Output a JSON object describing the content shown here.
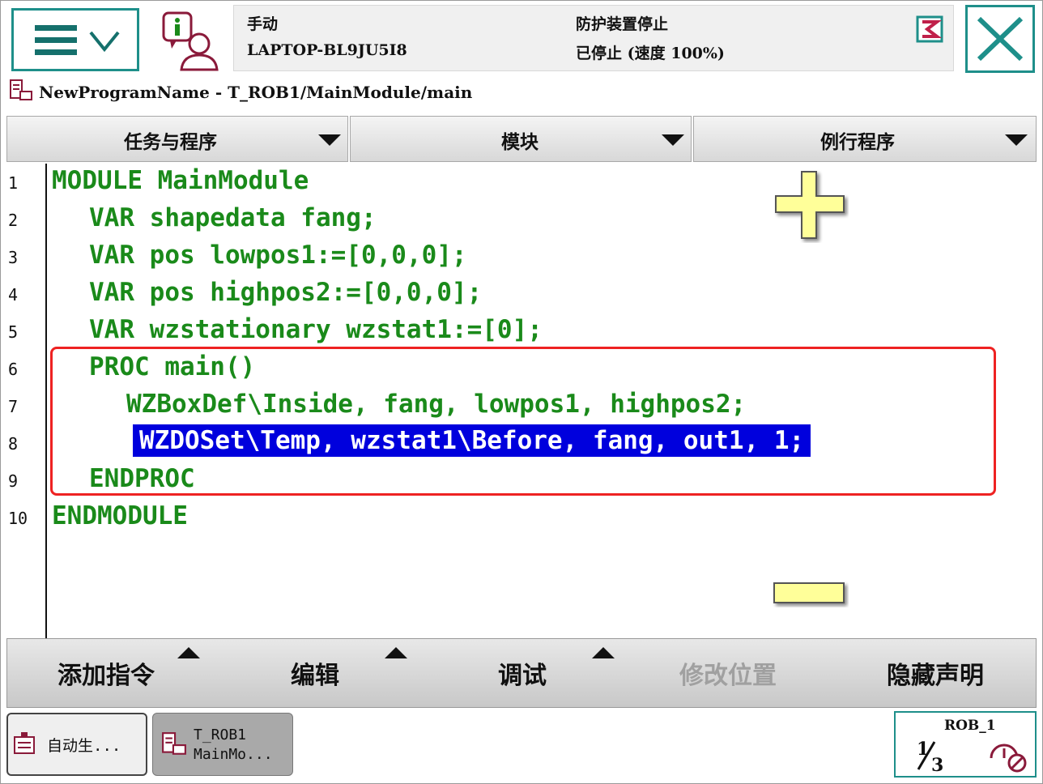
{
  "header": {
    "mode": "手动",
    "host": "LAPTOP-BL9JU5I8",
    "safety_status": "防护装置停止",
    "run_status": "已停止 (速度 100%)"
  },
  "breadcrumb": "NewProgramName - T_ROB1/MainModule/main",
  "dropdowns": [
    {
      "label": "任务与程序"
    },
    {
      "label": "模块"
    },
    {
      "label": "例行程序"
    }
  ],
  "code": {
    "line_numbers": [
      "1",
      "2",
      "3",
      "4",
      "5",
      "6",
      "7",
      "8",
      "9",
      "10"
    ],
    "lines": [
      "MODULE MainModule",
      "VAR shapedata fang;",
      "VAR pos lowpos1:=[0,0,0];",
      "VAR pos highpos2:=[0,0,0];",
      "VAR wzstationary wzstat1:=[0];",
      "PROC main()",
      "WZBoxDef\\Inside, fang, lowpos1, highpos2;",
      "WZDOSet\\Temp, wzstat1\\Before, fang, out1, 1;",
      "ENDPROC",
      "ENDMODULE"
    ],
    "selected_line": "8"
  },
  "toolbar": {
    "add_instruction": "添加指令",
    "edit": "编辑",
    "debug": "调试",
    "modify_position": "修改位置",
    "hide_declarations": "隐藏声明"
  },
  "taskbar": {
    "task1_label": "自动生...",
    "task2_line1": "T_ROB1",
    "task2_line2": "MainMo...",
    "rob_label": "ROB_1"
  },
  "colors": {
    "accent": "#1e8f8a",
    "code_text": "#1a8a1a",
    "selection": "#0000dd",
    "annotation_box": "#ee2222",
    "zoom_buttons": "#ffff99"
  }
}
